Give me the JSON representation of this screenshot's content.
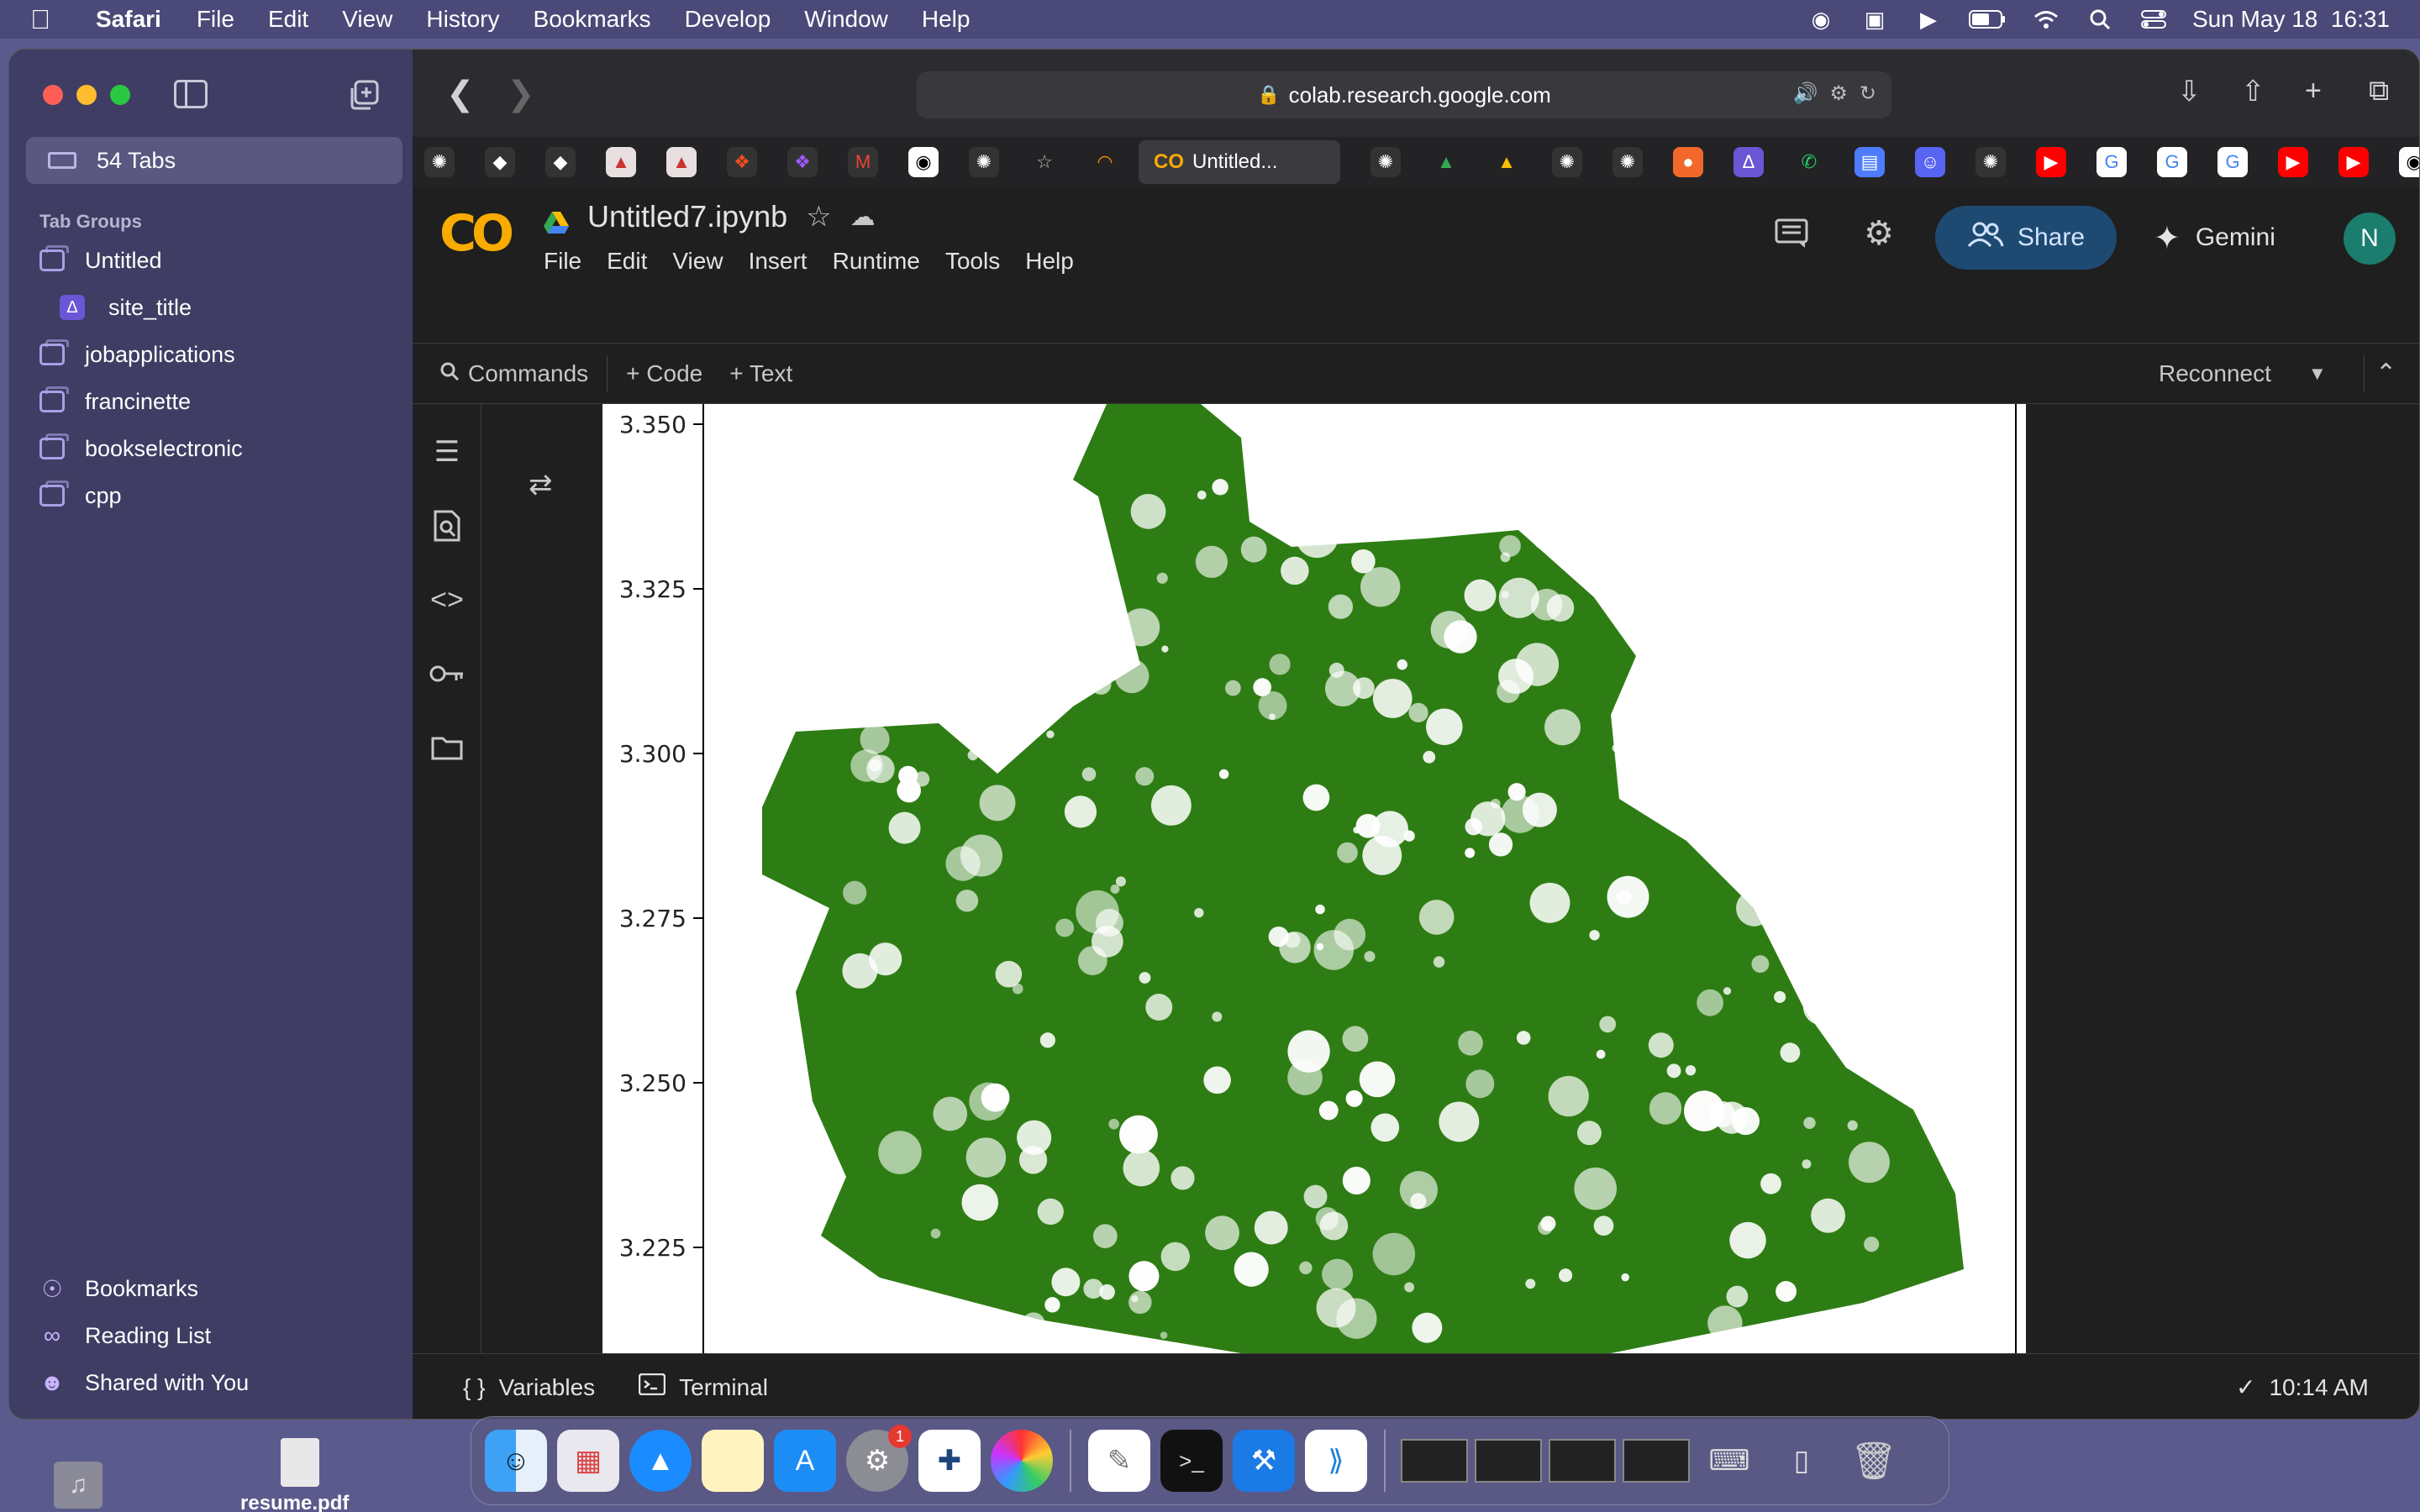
{
  "menubar": {
    "app_name": "Safari",
    "items": [
      "File",
      "Edit",
      "View",
      "History",
      "Bookmarks",
      "Develop",
      "Window",
      "Help"
    ],
    "datetime": "Sun May 18  16:31"
  },
  "safari": {
    "sidebar": {
      "tabs_count_label": "54 Tabs",
      "tab_groups_header": "Tab Groups",
      "groups": [
        "Untitled",
        "site_title",
        "jobapplications",
        "francinette",
        "bookselectronic",
        "cpp"
      ],
      "bottom": [
        "Bookmarks",
        "Reading List",
        "Shared with You"
      ]
    },
    "url": "colab.research.google.com",
    "active_tab_label": "Untitled..."
  },
  "colab": {
    "logo": "CO",
    "notebook_title": "Untitled7.ipynb",
    "menu": [
      "File",
      "Edit",
      "View",
      "Insert",
      "Runtime",
      "Tools",
      "Help"
    ],
    "share_label": "Share",
    "gemini_label": "Gemini",
    "avatar_initial": "N",
    "toolbar": {
      "commands_label": "Commands",
      "code_label": "+ Code",
      "text_label": "+ Text",
      "reconnect_label": "Reconnect"
    },
    "statusbar": {
      "variables_label": "Variables",
      "terminal_label": "Terminal",
      "time": "10:14 AM"
    }
  },
  "chart_data": {
    "type": "map",
    "yticks": [
      "3.350",
      "3.325",
      "3.300",
      "3.275",
      "3.250",
      "3.225"
    ],
    "ytick_values": [
      3.35,
      3.325,
      3.3,
      3.275,
      3.25,
      3.225
    ],
    "fill_color": "#2e7d14"
  },
  "desktop": {
    "file_label": "resume.pdf"
  },
  "colors": {
    "colab_orange": "#f9ab00",
    "share_bg": "#1e4a72",
    "plot_green": "#2e7d14"
  }
}
